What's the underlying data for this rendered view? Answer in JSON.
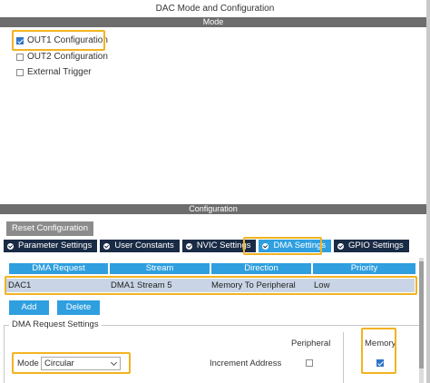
{
  "window": {
    "title": "DAC Mode and Configuration"
  },
  "mode": {
    "header": "Mode",
    "options": [
      {
        "label": "OUT1 Configuration",
        "checked": true
      },
      {
        "label": "OUT2 Configuration",
        "checked": false
      },
      {
        "label": "External Trigger",
        "checked": false
      }
    ]
  },
  "configuration": {
    "header": "Configuration",
    "reset_label": "Reset Configuration",
    "tabs": [
      {
        "label": "Parameter Settings",
        "active": false
      },
      {
        "label": "User Constants",
        "active": false
      },
      {
        "label": "NVIC Settings",
        "active": false
      },
      {
        "label": "DMA Settings",
        "active": true
      },
      {
        "label": "GPIO Settings",
        "active": false
      }
    ]
  },
  "dma_table": {
    "columns": [
      "DMA Request",
      "Stream",
      "Direction",
      "Priority"
    ],
    "rows": [
      {
        "request": "DAC1",
        "stream": "DMA1 Stream 5",
        "direction": "Memory To Peripheral",
        "priority": "Low"
      }
    ],
    "add_label": "Add",
    "delete_label": "Delete"
  },
  "request_settings": {
    "title": "DMA Request Settings",
    "mode_label": "Mode",
    "mode_value": "Circular",
    "peripheral_label": "Peripheral",
    "memory_label": "Memory",
    "increment_label": "Increment Address",
    "peripheral_increment": false,
    "memory_increment": true
  },
  "colors": {
    "highlight": "#f2b321",
    "accent": "#2f9fe0",
    "tab_dark": "#1a2b45",
    "header_bar": "#6d6d6d"
  }
}
